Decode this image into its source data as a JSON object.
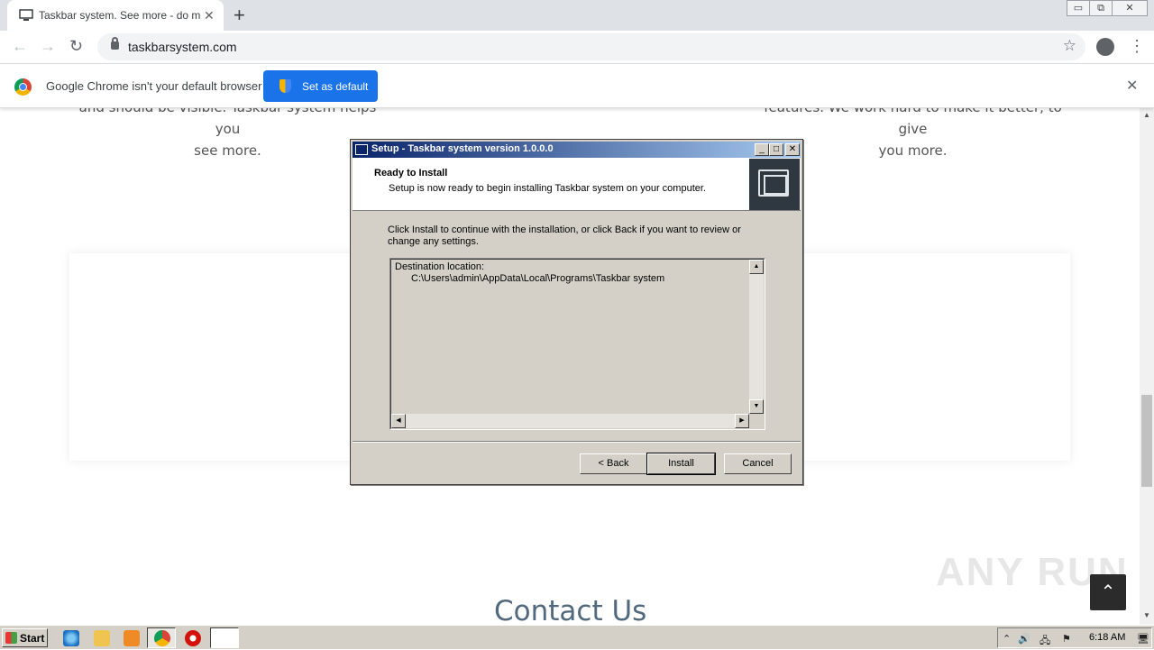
{
  "browser": {
    "tab_title": "Taskbar system. See more - do more",
    "tab_close": "✕",
    "new_tab": "+",
    "url": "taskbarsystem.com",
    "window_controls": [
      "▭",
      "⧉",
      "✕"
    ],
    "back": "←",
    "forward": "→",
    "reload": "↻",
    "star": "☆",
    "menu": "⋮"
  },
  "infobar": {
    "message": "Google Chrome isn't your default browser",
    "button": "Set as default",
    "close": "✕"
  },
  "page": {
    "left_col": [
      "and should be visible. Taskbar system helps you",
      "see more."
    ],
    "right_col": [
      "features. We work hard to make it better, to give",
      "you more."
    ],
    "contact_heading": "Contact Us",
    "watermark": "ANY RUN",
    "back_to_top": "⌃"
  },
  "dialog": {
    "title": "Setup - Taskbar system version 1.0.0.0",
    "title_buttons": [
      "_",
      "□",
      "✕"
    ],
    "heading": "Ready to Install",
    "subheading": "Setup is now ready to begin installing Taskbar system on your computer.",
    "body": "Click Install to continue with the installation, or click Back if you want to review or change any settings.",
    "memo_line1": "Destination location:",
    "memo_line2": "C:\\Users\\admin\\AppData\\Local\\Programs\\Taskbar system",
    "buttons": {
      "back": "< Back",
      "install": "Install",
      "cancel": "Cancel"
    },
    "scroll_up": "▲",
    "scroll_down": "▼",
    "scroll_left": "◀",
    "scroll_right": "▶"
  },
  "taskbar": {
    "start": "Start",
    "clock": "6:18 AM",
    "tray_icons": [
      "⌃",
      "🔊",
      "🖧",
      "⚑",
      "🖥"
    ]
  },
  "colors": {
    "accent": "#1a73e8",
    "dialog_face": "#d4d0c8",
    "title_gradient_start": "#0a246a",
    "title_gradient_end": "#a6caf0"
  }
}
